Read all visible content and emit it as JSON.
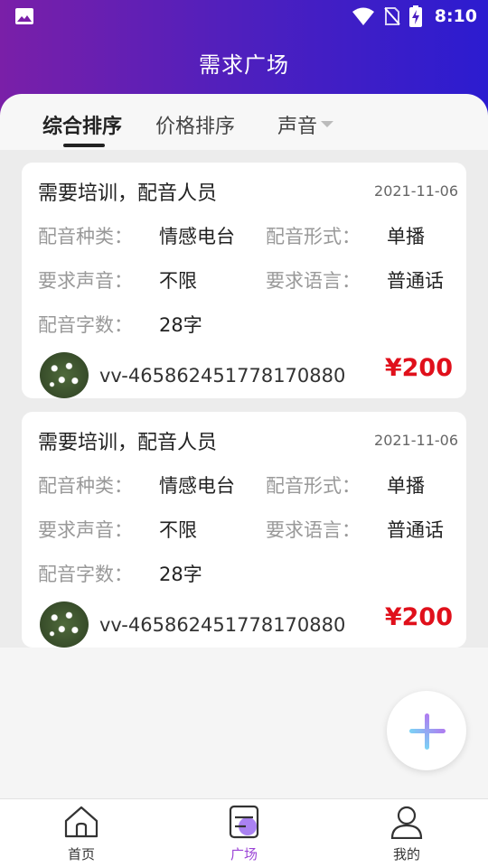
{
  "status_bar": {
    "time": "8:10"
  },
  "header": {
    "title": "需求广场"
  },
  "tabs": [
    {
      "label": "综合排序",
      "active": true
    },
    {
      "label": "价格排序",
      "active": false
    },
    {
      "label": "声音",
      "active": false
    }
  ],
  "cards": [
    {
      "title": "需要培训，配音人员",
      "date": "2021-11-06",
      "type_label": "配音种类：",
      "type_value": "情感电台",
      "form_label": "配音形式：",
      "form_value": "单播",
      "voice_label": "要求声音：",
      "voice_value": "不限",
      "lang_label": "要求语言：",
      "lang_value": "普通话",
      "words_label": "配音字数：",
      "words_value": "28字",
      "username": "vv-465862451778170880",
      "price": "¥200"
    },
    {
      "title": "需要培训，配音人员",
      "date": "2021-11-06",
      "type_label": "配音种类：",
      "type_value": "情感电台",
      "form_label": "配音形式：",
      "form_value": "单播",
      "voice_label": "要求声音：",
      "voice_value": "不限",
      "lang_label": "要求语言：",
      "lang_value": "普通话",
      "words_label": "配音字数：",
      "words_value": "28字",
      "username": "vv-465862451778170880",
      "price": "¥200"
    }
  ],
  "bottom_nav": [
    {
      "label": "首页",
      "icon": "home-icon",
      "active": false
    },
    {
      "label": "广场",
      "icon": "square-icon",
      "active": true
    },
    {
      "label": "我的",
      "icon": "user-icon",
      "active": false
    }
  ],
  "colors": {
    "accent": "#9b44d6",
    "price": "#e0101b",
    "header_start": "#7a1fa8",
    "header_end": "#2c1cd0"
  }
}
